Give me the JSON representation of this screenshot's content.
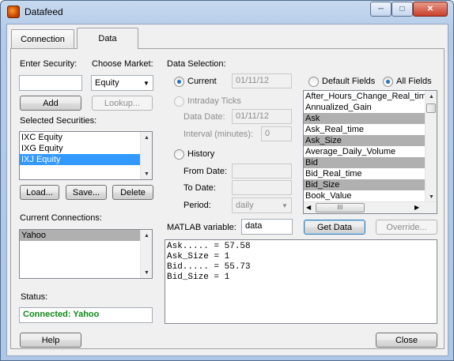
{
  "window": {
    "title": "Datafeed"
  },
  "tabs": [
    {
      "label": "Connection",
      "active": false
    },
    {
      "label": "Data",
      "active": true
    }
  ],
  "security": {
    "enter_label": "Enter Security:",
    "value": "",
    "add_label": "Add",
    "market_label": "Choose Market:",
    "market_value": "Equity",
    "lookup_label": "Lookup..."
  },
  "selected": {
    "label": "Selected Securities:",
    "items": [
      "IXC Equity",
      "IXG Equity",
      "IXJ Equity"
    ],
    "selected_index": 2,
    "load_label": "Load...",
    "save_label": "Save...",
    "delete_label": "Delete"
  },
  "connections": {
    "label": "Current Connections:",
    "items": [
      "Yahoo"
    ]
  },
  "status": {
    "label": "Status:",
    "value": "Connected: Yahoo",
    "color": "#118a1a"
  },
  "data_selection": {
    "label": "Data Selection:",
    "current_label": "Current",
    "current_date": "01/11/12",
    "intraday_label": "Intraday Ticks",
    "data_date_label": "Data Date:",
    "data_date_value": "01/11/12",
    "interval_label": "Interval (minutes):",
    "interval_value": "0",
    "history_label": "History",
    "from_label": "From Date:",
    "from_value": "",
    "to_label": "To Date:",
    "to_value": "",
    "period_label": "Period:",
    "period_value": "daily"
  },
  "fields": {
    "default_label": "Default Fields",
    "all_label": "All Fields",
    "items": [
      "After_Hours_Change_Real_time",
      "Annualized_Gain",
      "Ask",
      "Ask_Real_time",
      "Ask_Size",
      "Average_Daily_Volume",
      "Bid",
      "Bid_Real_time",
      "Bid_Size",
      "Book_Value"
    ],
    "highlighted": [
      "Ask",
      "Ask_Size",
      "Bid",
      "Bid_Size"
    ],
    "hscroll_grip": "III"
  },
  "matlab": {
    "label": "MATLAB variable:",
    "value": "data",
    "get_data_label": "Get Data",
    "override_label": "Override..."
  },
  "output": {
    "lines": [
      "Ask..... = 57.58",
      "Ask_Size = 1",
      "Bid..... = 55.73",
      "Bid_Size = 1"
    ]
  },
  "footer": {
    "help_label": "Help",
    "close_label": "Close"
  }
}
